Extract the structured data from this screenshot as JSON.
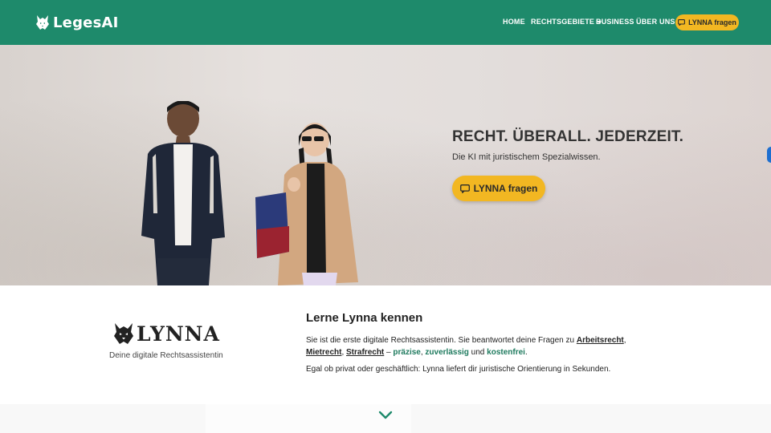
{
  "header": {
    "brand": "LegesAI",
    "nav": [
      {
        "label": "HOME"
      },
      {
        "label": "RECHTSGEBIETE"
      },
      {
        "label": "BUSINESS"
      },
      {
        "label": "ÜBER UNS"
      }
    ],
    "cta_label": "LYNNA fragen"
  },
  "hero": {
    "title": "RECHT. ÜBERALL. JEDERZEIT.",
    "subtitle": "Die KI mit juristischem Spezialwissen.",
    "cta_label": "LYNNA fragen"
  },
  "intro": {
    "logo_word": "LYNNA",
    "tagline": "Deine digitale Rechtsassistentin",
    "title": "Lerne Lynna kennen",
    "p1_lead": "Sie ist die erste digitale Rechtsassistentin. Sie beantwortet deine Fragen zu ",
    "link_arbeitsrecht": "Arbeitsrecht",
    "sep1": ", ",
    "link_mietrecht": "Mietrecht",
    "sep2": ", ",
    "link_strafrecht": "Strafrecht",
    "dash": " – ",
    "hl_praezise": "präzise",
    "sep3": ", ",
    "hl_zuverlaessig": "zuverlässig",
    "und": " und ",
    "hl_kostenfrei": "kostenfrei",
    "period": ".",
    "p2": "Egal ob privat oder geschäftlich: Lynna liefert dir juristische Orientierung in Sekunden."
  },
  "colors": {
    "header_bg": "#1e8a6b",
    "accent_yellow": "#f2b722",
    "highlight_green": "#1e7a5e"
  },
  "icons": {
    "brand": "lynx-head-icon",
    "cta": "chat-bubble-icon",
    "scroll": "chevron-down-icon"
  }
}
